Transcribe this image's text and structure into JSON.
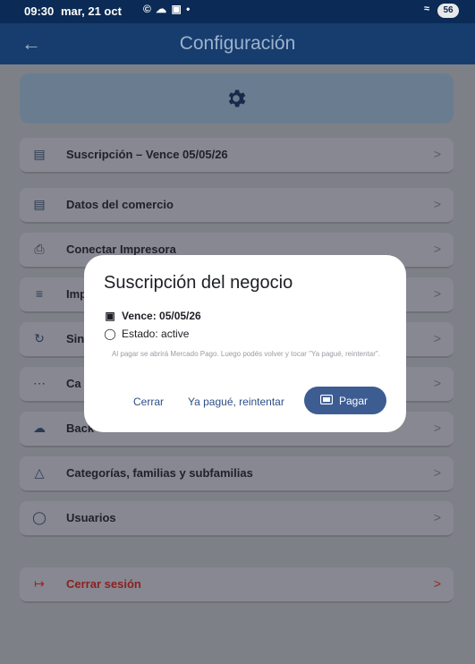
{
  "status_bar": {
    "time": "09:30",
    "date": "mar, 21 oct",
    "icons": "© ☁ ▣ •",
    "battery": "56"
  },
  "app_bar": {
    "title": "Configuración",
    "back_icon": "←"
  },
  "menu": [
    {
      "label": "Suscripción – Vence 05/05/26",
      "icon": "subscription-icon"
    },
    {
      "label": "Datos del comercio",
      "icon": "store-icon"
    },
    {
      "label": "Conectar Impresora",
      "icon": "printer-icon"
    },
    {
      "label": "Imp",
      "icon": "import-icon"
    },
    {
      "label": "Sin",
      "icon": "sync-icon"
    },
    {
      "label": "Ca",
      "icon": "keyboard-icon"
    },
    {
      "label": "Back",
      "icon": "cloud-icon"
    },
    {
      "label": "Categorías, familias y subfamilias",
      "icon": "category-icon"
    },
    {
      "label": "Usuarios",
      "icon": "users-icon"
    }
  ],
  "logout": {
    "label": "Cerrar sesión",
    "icon": "logout-icon"
  },
  "chevron": ">",
  "dialog": {
    "title": "Suscripción del negocio",
    "expires": "Vence: 05/05/26",
    "state": "Estado: active",
    "note": "Al pagar se abrirá Mercado Pago. Luego podés volver y tocar \"Ya pagué, reintentar\".",
    "close_label": "Cerrar",
    "retry_label": "Ya pagué, reintentar",
    "pay_label": "Pagar"
  },
  "colors": {
    "app_bar": "#163d6e",
    "status_bar": "#0b2a55",
    "pay_button": "#3d5d92",
    "logout_text": "#8c1f1f"
  }
}
